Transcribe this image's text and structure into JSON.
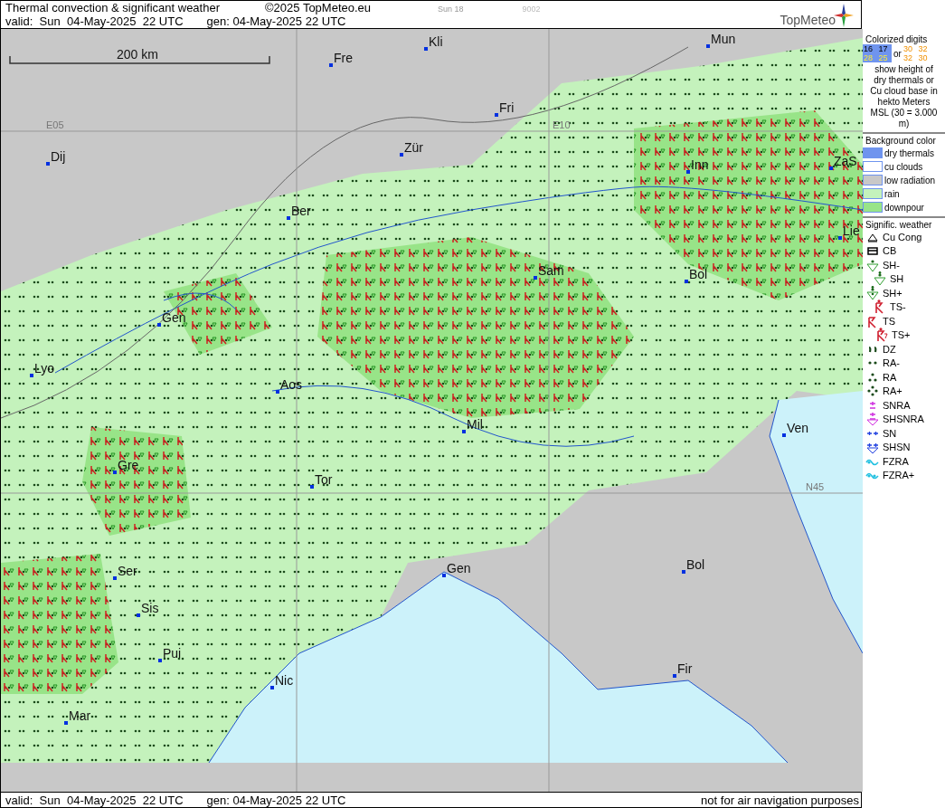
{
  "header": {
    "title": "Thermal convection & significant weather",
    "copyright": "©2025 TopMeteo.eu",
    "day_code": "Sun 18",
    "code": "9002",
    "valid": "valid:  Sun  04-May-2025  22 UTC",
    "generated": "gen: 04-May-2025 22 UTC",
    "logo": "TopMeteo"
  },
  "map": {
    "scale": "200 km",
    "grid_labels": [
      "E05",
      "E10",
      "N45"
    ],
    "cities": [
      "Kli",
      "Mun",
      "Fre",
      "Fri",
      "Dij",
      "Zür",
      "Inn",
      "ZaS",
      "Ber",
      "Lie",
      "Sam",
      "Bol",
      "Gen",
      "Lyo",
      "Aos",
      "Ven",
      "Mil",
      "Gre",
      "Tor",
      "Ser",
      "Gen",
      "Bol",
      "Sis",
      "Pui",
      "Fir",
      "Nic",
      "Mar"
    ]
  },
  "legend": {
    "digits_title": "Colorized digits",
    "dry_digits": [
      "16",
      "17",
      "28",
      "25"
    ],
    "or": "or",
    "cu_digits": [
      "30",
      "32",
      "32",
      "30"
    ],
    "digits_note": "show height of dry thermals or Cu cloud base in hekto Meters MSL (30 = 3.000 m)",
    "background_title": "Background color",
    "backgrounds": [
      {
        "label": "dry thermals",
        "color": "#6f94ee"
      },
      {
        "label": "cu clouds",
        "color": "#ffffff"
      },
      {
        "label": "low radiation",
        "color": "#c8c8c8"
      },
      {
        "label": "rain",
        "color": "#c4f2bc"
      },
      {
        "label": "downpour",
        "color": "#98e488"
      }
    ],
    "weather_title": "Signific. weather",
    "weather": [
      {
        "kind": "cu_cong",
        "label": "Cu Cong"
      },
      {
        "kind": "cb",
        "label": "CB"
      },
      {
        "kind": "sh_light",
        "label": "SH-"
      },
      {
        "kind": "sh",
        "label": "SH"
      },
      {
        "kind": "sh_heavy",
        "label": "SH+"
      },
      {
        "kind": "ts_light",
        "label": "TS-"
      },
      {
        "kind": "ts",
        "label": "TS"
      },
      {
        "kind": "ts_heavy",
        "label": "TS+"
      },
      {
        "kind": "dz",
        "label": "DZ"
      },
      {
        "kind": "ra_light",
        "label": "RA-"
      },
      {
        "kind": "ra",
        "label": "RA"
      },
      {
        "kind": "ra_heavy",
        "label": "RA+"
      },
      {
        "kind": "snra",
        "label": "SNRA"
      },
      {
        "kind": "shsnra",
        "label": "SHSNRA"
      },
      {
        "kind": "sn",
        "label": "SN"
      },
      {
        "kind": "shsn",
        "label": "SHSN"
      },
      {
        "kind": "fzra",
        "label": "FZRA"
      },
      {
        "kind": "fzra_heavy",
        "label": "FZRA+"
      }
    ]
  },
  "footer": {
    "valid": "valid:  Sun  04-May-2025  22 UTC",
    "generated": "gen: 04-May-2025 22 UTC",
    "disclaimer": "not for air navigation purposes"
  }
}
